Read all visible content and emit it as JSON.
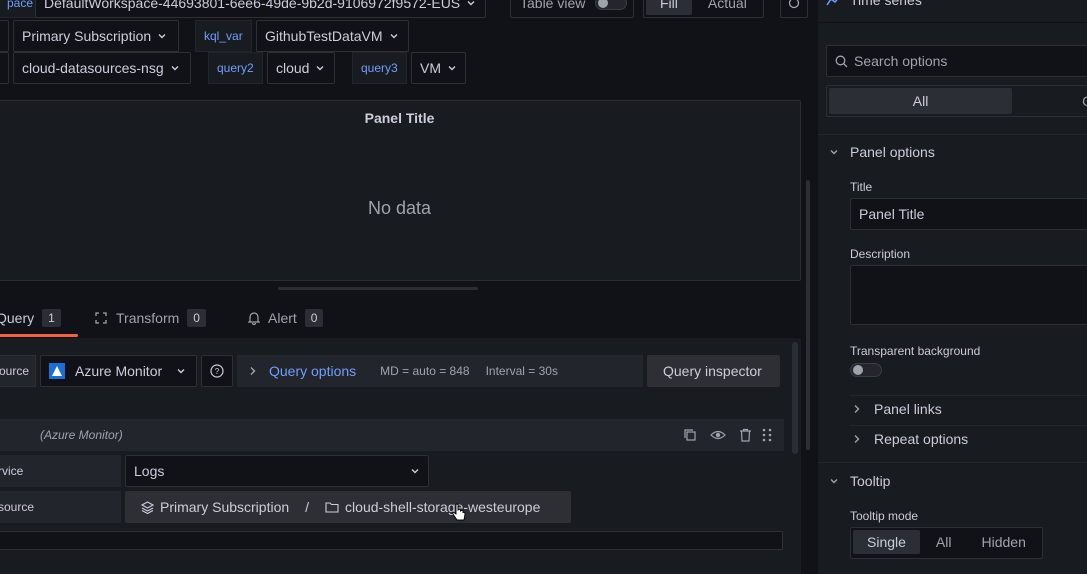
{
  "variables": {
    "row1": {
      "workspace_label": "pace",
      "workspace_value": "DefaultWorkspace-44693801-6ee6-49de-9b2d-9106972f9572-EUS"
    },
    "row2": {
      "subscription_value": "Primary Subscription",
      "kql_label": "kql_var",
      "kql_value": "GithubTestDataVM"
    },
    "row3": {
      "nsg_value": "cloud-datasources-nsg",
      "query2_label": "query2",
      "query2_value": "cloud",
      "query3_label": "query3",
      "query3_value": "VM"
    }
  },
  "toolbar": {
    "table_view_label": "Table view",
    "fill_label": "Fill",
    "actual_label": "Actual"
  },
  "panel": {
    "title": "Panel Title",
    "no_data": "No data"
  },
  "tabs": [
    {
      "label": "Query",
      "count": "1"
    },
    {
      "label": "Transform",
      "count": "0"
    },
    {
      "label": "Alert",
      "count": "0"
    }
  ],
  "query_row": {
    "datasource_label": "ource",
    "datasource_value": "Azure Monitor",
    "query_options_label": "Query options",
    "md_text": "MD = auto = 848",
    "interval_text": "Interval = 30s",
    "inspector_label": "Query inspector"
  },
  "query_editor": {
    "header_ds": "(Azure Monitor)",
    "service_label": "rvice",
    "service_value": "Logs",
    "resource_label": "source",
    "resource_subscription": "Primary Subscription",
    "resource_separator": "/",
    "resource_group": "cloud-shell-storage-westeurope"
  },
  "sidebar": {
    "viz_name": "Time series",
    "search_placeholder": "Search options",
    "filter_all": "All",
    "filter_overrides": "O",
    "panel_options_title": "Panel options",
    "title_label": "Title",
    "title_value": "Panel Title",
    "description_label": "Description",
    "transparent_label": "Transparent background",
    "panel_links": "Panel links",
    "repeat_options": "Repeat options",
    "tooltip_title": "Tooltip",
    "tooltip_mode_label": "Tooltip mode",
    "tooltip_modes": [
      "Single",
      "All",
      "Hidden"
    ]
  },
  "colors": {
    "accent_blue": "#6e9fff",
    "tab_active_underline": "#f55f3e",
    "background": "#111217",
    "panel": "#181b1f"
  }
}
